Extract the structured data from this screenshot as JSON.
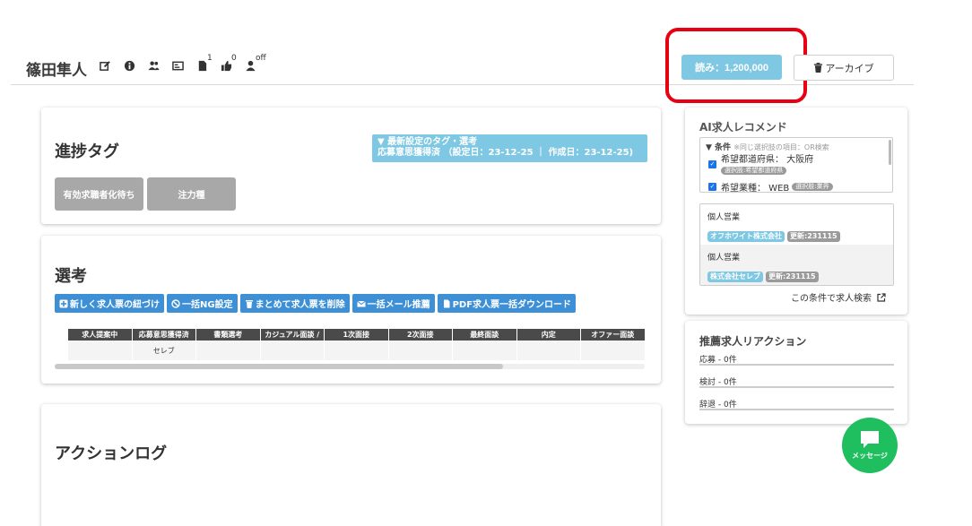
{
  "candidate": {
    "name": "篠田隼人",
    "document_count": "1",
    "like_count": "0",
    "agent_status": "off"
  },
  "header_buttons": {
    "reading_label": "読み：1,200,000",
    "archive_label": "アーカイブ"
  },
  "progress_card": {
    "title": "進捗タグ",
    "latest_tag_line1": "▼ 最新設定のタグ・選考",
    "latest_tag_line2": "応募意思獲得済 （設定日：23-12-25 ｜ 作成日：23-12-25)",
    "tags": [
      "有効求職者化待ち",
      "注力種"
    ]
  },
  "selection_card": {
    "title": "選考",
    "actions": [
      "新しく求人票の紐づけ",
      "一括NG設定",
      "まとめて求人票を削除",
      "一括メール推薦",
      "PDF求人票一括ダウンロード"
    ],
    "columns": [
      "求人提案中",
      "応募意思獲得済",
      "書類選考",
      "カジュアル面談 /",
      "1次面接",
      "2次面接",
      "最終面談",
      "内定",
      "オファー面談"
    ],
    "rows": [
      [
        "",
        "セレブ",
        "",
        "",
        "",
        "",
        "",
        "",
        ""
      ]
    ],
    "scroll_fraction": 0.76
  },
  "actionlog_card": {
    "title": "アクションログ"
  },
  "ai_recommend": {
    "title": "AI求人レコメンド",
    "conditions_header": "▼ 条件",
    "conditions_note": "※同じ選択肢の項目：OR検索",
    "conditions": [
      {
        "label": "希望都道府県： 大阪府",
        "source": "選択肢:希望都道府県",
        "checked": true
      },
      {
        "label": "希望業種： WEB",
        "source": "選択肢:業界",
        "checked": true
      }
    ],
    "results": [
      {
        "type": "個人営業",
        "company": "オフホワイト株式会社",
        "updated": "更新:231115"
      },
      {
        "type": "個人営業",
        "company": "株式会社セレブ",
        "updated": "更新:231115"
      }
    ],
    "search_link": "この条件で求人検索"
  },
  "reactions": {
    "title": "推薦求人リアクション",
    "items": [
      "応募 - 0件",
      "検討 - 0件",
      "辞退 - 0件"
    ]
  },
  "message_button": {
    "label": "メッセージ"
  },
  "colors": {
    "accent_light_blue": "#7ec8e3",
    "action_blue": "#3d8fd6",
    "highlight_red": "#e60012",
    "message_green": "#1fbe5e"
  }
}
